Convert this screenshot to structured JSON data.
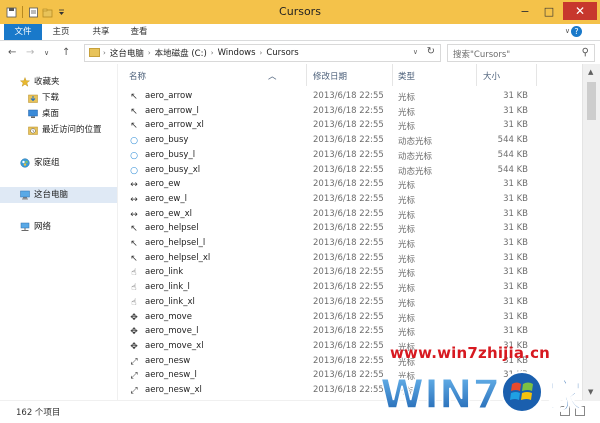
{
  "window": {
    "title": "Cursors",
    "controls": {
      "minimize": "−",
      "maximize": "□",
      "close": "✕"
    }
  },
  "ribbon": {
    "tabs": [
      "文件",
      "主页",
      "共享",
      "查看"
    ],
    "help": "?"
  },
  "address": {
    "crumbs": [
      "这台电脑",
      "本地磁盘 (C:)",
      "Windows",
      "Cursors"
    ],
    "search_placeholder": "搜索\"Cursors\""
  },
  "nav": {
    "items": [
      {
        "label": "收藏夹",
        "icon": "star-icon",
        "indent": 0
      },
      {
        "label": "下载",
        "icon": "download-folder-icon",
        "indent": 1
      },
      {
        "label": "桌面",
        "icon": "desktop-icon",
        "indent": 1
      },
      {
        "label": "最近访问的位置",
        "icon": "recent-places-icon",
        "indent": 1
      },
      {
        "label": "家庭组",
        "icon": "homegroup-icon",
        "indent": 0
      },
      {
        "label": "这台电脑",
        "icon": "computer-icon",
        "indent": 0,
        "selected": true
      },
      {
        "label": "网络",
        "icon": "network-icon",
        "indent": 0
      }
    ]
  },
  "columns": [
    "名称",
    "修改日期",
    "类型",
    "大小"
  ],
  "files": [
    {
      "name": "aero_arrow",
      "date": "2013/6/18 22:55",
      "type": "光标",
      "size": "31 KB",
      "icon": "↖"
    },
    {
      "name": "aero_arrow_l",
      "date": "2013/6/18 22:55",
      "type": "光标",
      "size": "31 KB",
      "icon": "↖"
    },
    {
      "name": "aero_arrow_xl",
      "date": "2013/6/18 22:55",
      "type": "光标",
      "size": "31 KB",
      "icon": "↖"
    },
    {
      "name": "aero_busy",
      "date": "2013/6/18 22:55",
      "type": "动态光标",
      "size": "544 KB",
      "icon": "○"
    },
    {
      "name": "aero_busy_l",
      "date": "2013/6/18 22:55",
      "type": "动态光标",
      "size": "544 KB",
      "icon": "○"
    },
    {
      "name": "aero_busy_xl",
      "date": "2013/6/18 22:55",
      "type": "动态光标",
      "size": "544 KB",
      "icon": "○"
    },
    {
      "name": "aero_ew",
      "date": "2013/6/18 22:55",
      "type": "光标",
      "size": "31 KB",
      "icon": "↔"
    },
    {
      "name": "aero_ew_l",
      "date": "2013/6/18 22:55",
      "type": "光标",
      "size": "31 KB",
      "icon": "↔"
    },
    {
      "name": "aero_ew_xl",
      "date": "2013/6/18 22:55",
      "type": "光标",
      "size": "31 KB",
      "icon": "↔"
    },
    {
      "name": "aero_helpsel",
      "date": "2013/6/18 22:55",
      "type": "光标",
      "size": "31 KB",
      "icon": "↖"
    },
    {
      "name": "aero_helpsel_l",
      "date": "2013/6/18 22:55",
      "type": "光标",
      "size": "31 KB",
      "icon": "↖"
    },
    {
      "name": "aero_helpsel_xl",
      "date": "2013/6/18 22:55",
      "type": "光标",
      "size": "31 KB",
      "icon": "↖"
    },
    {
      "name": "aero_link",
      "date": "2013/6/18 22:55",
      "type": "光标",
      "size": "31 KB",
      "icon": "☝"
    },
    {
      "name": "aero_link_l",
      "date": "2013/6/18 22:55",
      "type": "光标",
      "size": "31 KB",
      "icon": "☝"
    },
    {
      "name": "aero_link_xl",
      "date": "2013/6/18 22:55",
      "type": "光标",
      "size": "31 KB",
      "icon": "☝"
    },
    {
      "name": "aero_move",
      "date": "2013/6/18 22:55",
      "type": "光标",
      "size": "31 KB",
      "icon": "✥"
    },
    {
      "name": "aero_move_l",
      "date": "2013/6/18 22:55",
      "type": "光标",
      "size": "31 KB",
      "icon": "✥"
    },
    {
      "name": "aero_move_xl",
      "date": "2013/6/18 22:55",
      "type": "光标",
      "size": "31 KB",
      "icon": "✥"
    },
    {
      "name": "aero_nesw",
      "date": "2013/6/18 22:55",
      "type": "光标",
      "size": "31 KB",
      "icon": "⤢"
    },
    {
      "name": "aero_nesw_l",
      "date": "2013/6/18 22:55",
      "type": "光标",
      "size": "31 KB",
      "icon": "⤢"
    },
    {
      "name": "aero_nesw_xl",
      "date": "2013/6/18 22:55",
      "type": "光标",
      "size": "31 KB",
      "icon": "⤢"
    }
  ],
  "status": {
    "count": "162 个项目"
  },
  "watermark": {
    "url": "www.win7zhijia.cn",
    "logo_text": "WIN7",
    "logo_suffix": "家"
  },
  "colors": {
    "titlebar": "#f4c24a",
    "accent": "#1979ca",
    "close": "#c7372d",
    "header_text": "#4c607a",
    "watermark": "#d71920"
  }
}
